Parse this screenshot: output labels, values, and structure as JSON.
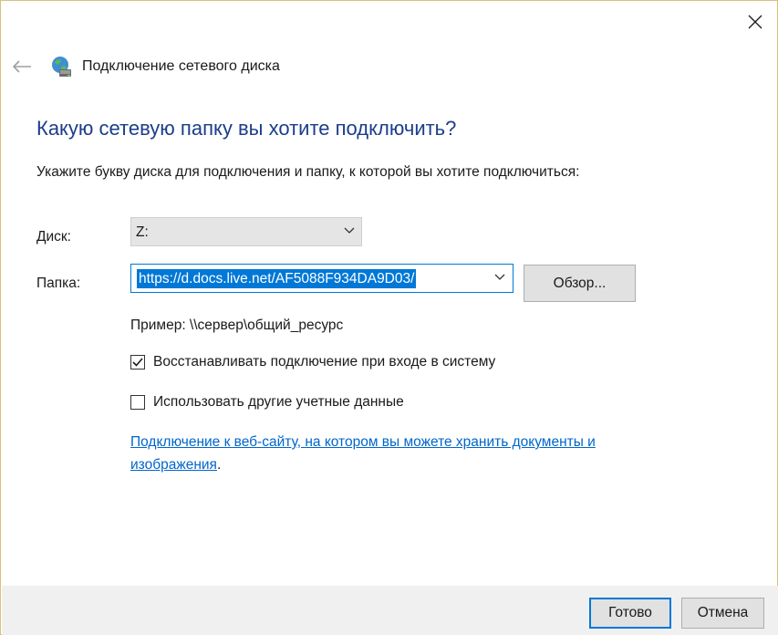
{
  "window": {
    "title": "Подключение сетевого диска"
  },
  "icons": {
    "close": "close-icon",
    "back": "back-arrow-icon",
    "wizard": "network-drive-icon",
    "dropdown": "chevron-down-icon",
    "check": "checkmark-icon"
  },
  "content": {
    "heading": "Какую сетевую папку вы хотите подключить?",
    "instruction": "Укажите букву диска для подключения и папку, к которой вы хотите подключиться:"
  },
  "drive": {
    "label": "Диск:",
    "value": "Z:"
  },
  "folder": {
    "label": "Папка:",
    "value": "https://d.docs.live.net/AF5088F934DA9D03/",
    "browse_label": "Обзор..."
  },
  "example": "Пример: \\\\сервер\\общий_ресурс",
  "options": {
    "reconnect": {
      "label": "Восстанавливать подключение при входе в систему",
      "checked": true
    },
    "other_credentials": {
      "label": "Использовать другие учетные данные",
      "checked": false
    }
  },
  "link": {
    "text": "Подключение к веб-сайту, на котором вы можете хранить документы и изображения",
    "suffix": "."
  },
  "footer": {
    "finish_label": "Готово",
    "cancel_label": "Отмена"
  },
  "colors": {
    "heading": "#1c3e8a",
    "accent": "#0078d7",
    "link": "#0066cc",
    "window_border": "#d9c27a"
  }
}
